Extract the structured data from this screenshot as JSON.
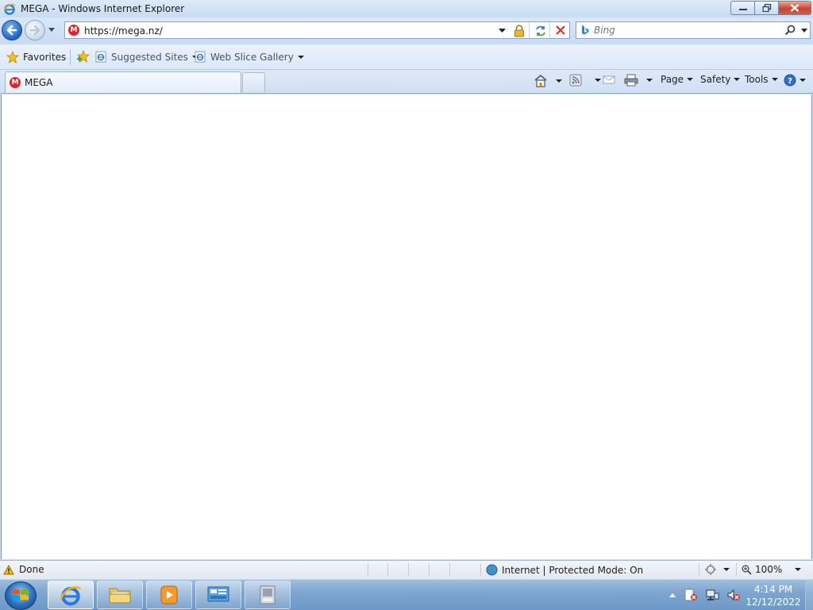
{
  "window": {
    "title": "MEGA - Windows Internet Explorer"
  },
  "address_bar": {
    "url": "https://mega.nz/",
    "site_icon_letter": "M"
  },
  "search": {
    "placeholder": "Bing"
  },
  "favorites_bar": {
    "favorites_label": "Favorites",
    "items": [
      {
        "label": "Suggested Sites"
      },
      {
        "label": "Web Slice Gallery"
      }
    ]
  },
  "tabs": [
    {
      "label": "MEGA",
      "icon_letter": "M",
      "active": true
    }
  ],
  "command_bar": {
    "page_label": "Page",
    "safety_label": "Safety",
    "tools_label": "Tools"
  },
  "status_bar": {
    "status_text": "Done",
    "zone_text": "Internet | Protected Mode: On",
    "zoom_text": "100%"
  },
  "taskbar": {
    "time": "4:14 PM",
    "date": "12/12/2022"
  },
  "colors": {
    "mega_red": "#d9272e",
    "chrome_blue": "#cfe0f4",
    "close_red": "#c8442f"
  },
  "icons": [
    "ie-logo-icon",
    "back-arrow-icon",
    "forward-arrow-icon",
    "lock-icon",
    "refresh-icon",
    "stop-icon",
    "bing-icon",
    "search-icon",
    "favorites-star-icon",
    "add-favorites-icon",
    "ie-page-icon",
    "home-icon",
    "rss-feed-icon",
    "read-mail-icon",
    "print-icon",
    "help-icon",
    "warning-icon",
    "globe-icon",
    "zoom-icon",
    "windows-logo-icon"
  ]
}
